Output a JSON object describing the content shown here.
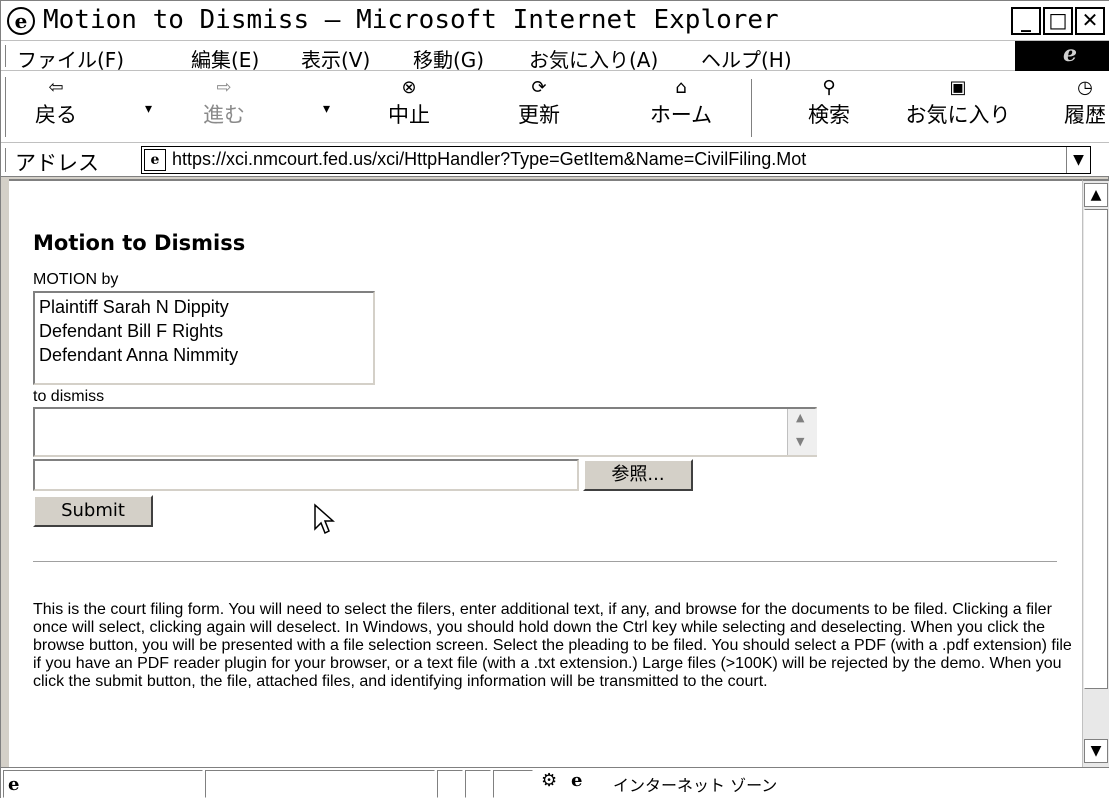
{
  "window": {
    "title": "Motion to Dismiss – Microsoft Internet Explorer",
    "controls": {
      "minimize": "_",
      "maximize": "□",
      "close": "✕"
    }
  },
  "menubar": {
    "items": [
      "ファイル(F)",
      "編集(E)",
      "表示(V)",
      "移動(G)",
      "お気に入り(A)",
      "ヘルプ(H)"
    ]
  },
  "toolbar": {
    "back": {
      "label": "戻る",
      "icon": "⇦"
    },
    "forward": {
      "label": "進む",
      "icon": "⇨"
    },
    "stop": {
      "label": "中止",
      "icon": "⊗"
    },
    "refresh": {
      "label": "更新",
      "icon": "⟳"
    },
    "home": {
      "label": "ホーム",
      "icon": "⌂"
    },
    "search": {
      "label": "検索",
      "icon": "⚲"
    },
    "favorites": {
      "label": "お気に入り",
      "icon": "▣"
    },
    "history": {
      "label": "履歴",
      "icon": "◷"
    },
    "dropdown_arrow": "▾"
  },
  "address": {
    "label": "アドレス",
    "url": "https://xci.nmcourt.fed.us/xci/HttpHandler?Type=GetItem&Name=CivilFiling.Mot"
  },
  "page": {
    "heading": "Motion to Dismiss",
    "motion_by_label": "MOTION by",
    "filers": [
      "Plaintiff Sarah N Dippity",
      "Defendant Bill F Rights",
      "Defendant Anna Nimmity"
    ],
    "to_dismiss_label": "to dismiss",
    "dismiss_text_value": "",
    "file_input_value": "",
    "browse_label": "参照...",
    "submit_label": "Submit",
    "instructions": "This is the court filing form. You will need to select the filers, enter additional text, if any, and browse for the documents to be filed. Clicking a filer once will select, clicking again will deselect. In Windows, you should hold down the Ctrl key while selecting and deselecting. When you click the browse button, you will be presented with a file selection screen. Select the pleading to be filed. You should select a PDF (with a .pdf extension) file if you have an PDF reader plugin for your browser, or a text file (with a .txt extension.) Large files (>100K) will be rejected by the demo. When you click the submit button, the file, attached files, and identifying information will be transmitted to the court."
  },
  "statusbar": {
    "zone": "インターネット ゾーン"
  }
}
